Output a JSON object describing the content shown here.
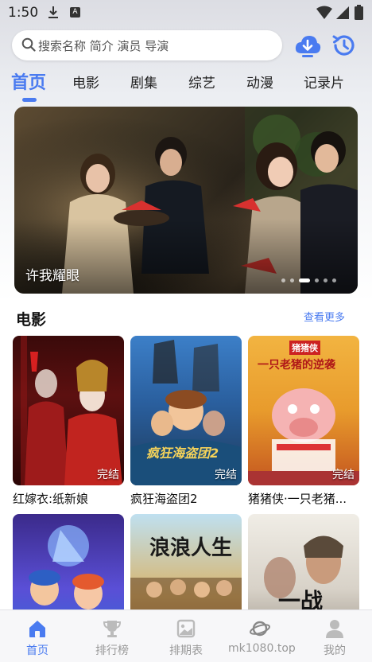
{
  "status_bar": {
    "time": "1:50",
    "a_badge": "A"
  },
  "search": {
    "placeholder": "搜索名称 简介 演员 导演"
  },
  "tabs": [
    {
      "label": "首页",
      "active": true
    },
    {
      "label": "电影"
    },
    {
      "label": "剧集"
    },
    {
      "label": "综艺"
    },
    {
      "label": "动漫"
    },
    {
      "label": "记录片"
    }
  ],
  "banner": {
    "title": "许我耀眼"
  },
  "section": {
    "title": "电影",
    "more_label": "查看更多"
  },
  "movies": [
    {
      "title": "红嫁衣:纸新娘",
      "badge": "完结"
    },
    {
      "title": "疯狂海盗团2",
      "badge": "完结",
      "poster_text": "疯狂海盗团2"
    },
    {
      "title": "猪猪侠·一只老猪...",
      "badge": "完结",
      "poster_text": "一只老猪的逆袭",
      "poster_top": "猪猪侠"
    },
    {
      "title": "",
      "badge": ""
    },
    {
      "title": "",
      "badge": "",
      "poster_text": "浪浪人生"
    },
    {
      "title": "",
      "badge": "",
      "poster_text": "一战"
    }
  ],
  "bottom_nav": [
    {
      "label": "首页",
      "icon": "home-icon",
      "active": true
    },
    {
      "label": "排行榜",
      "icon": "trophy-icon"
    },
    {
      "label": "排期表",
      "icon": "schedule-icon"
    },
    {
      "label": "mk1080.top",
      "icon": "planet-icon"
    },
    {
      "label": "我的",
      "icon": "user-icon"
    }
  ],
  "colors": {
    "accent": "#4a7bf0",
    "inactive": "#999999"
  }
}
